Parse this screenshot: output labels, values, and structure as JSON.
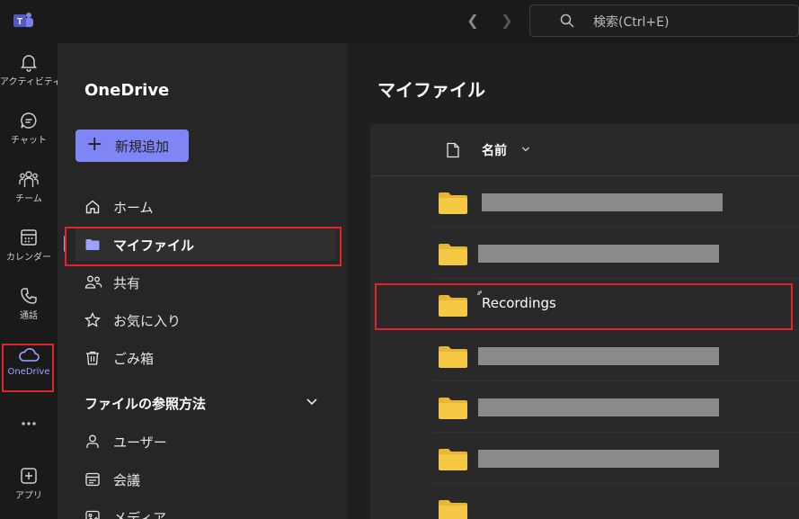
{
  "topbar": {
    "search_placeholder": "検索(Ctrl+E)"
  },
  "rail": {
    "items": [
      {
        "label": "アクティビティ",
        "icon": "bell-icon"
      },
      {
        "label": "チャット",
        "icon": "chat-icon"
      },
      {
        "label": "チーム",
        "icon": "teams-icon"
      },
      {
        "label": "カレンダー",
        "icon": "calendar-icon"
      },
      {
        "label": "通話",
        "icon": "phone-icon"
      },
      {
        "label": "OneDrive",
        "icon": "cloud-icon"
      },
      {
        "label": "",
        "icon": "more-icon"
      },
      {
        "label": "アプリ",
        "icon": "apps-icon"
      }
    ]
  },
  "sidebar": {
    "title": "OneDrive",
    "new_button": "新規追加",
    "items": [
      {
        "label": "ホーム",
        "icon": "home-icon"
      },
      {
        "label": "マイファイル",
        "icon": "folder-icon"
      },
      {
        "label": "共有",
        "icon": "people-icon"
      },
      {
        "label": "お気に入り",
        "icon": "star-icon"
      },
      {
        "label": "ごみ箱",
        "icon": "trash-icon"
      }
    ],
    "section_title": "ファイルの参照方法",
    "section_items": [
      {
        "label": "ユーザー",
        "icon": "person-icon"
      },
      {
        "label": "会議",
        "icon": "meeting-icon"
      },
      {
        "label": "メディア",
        "icon": "media-icon"
      }
    ]
  },
  "main": {
    "title": "マイファイル",
    "column_name": "名前",
    "rows": [
      {
        "name": "",
        "redacted": true
      },
      {
        "name": "",
        "redacted": true
      },
      {
        "name": "Recordings",
        "redacted": false
      },
      {
        "name": "",
        "redacted": true
      },
      {
        "name": "",
        "redacted": true
      },
      {
        "name": "",
        "redacted": true
      },
      {
        "name": "",
        "redacted": true
      }
    ]
  },
  "colors": {
    "accent": "#7f85f5",
    "active_text": "#9ea2ff",
    "highlight_box": "#e3242b",
    "folder": "#f6c945"
  }
}
